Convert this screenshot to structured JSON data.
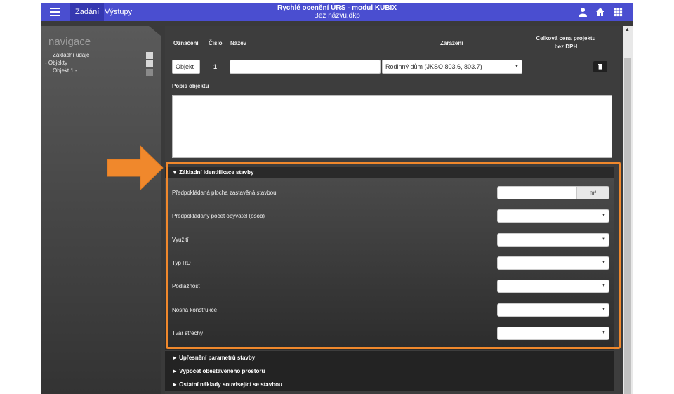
{
  "header": {
    "title": "Rychlé ocenění ÚRS - modul KUBIX",
    "subtitle": "Bez názvu.dkp",
    "tabs": [
      {
        "label": "Zadání",
        "active": true
      },
      {
        "label": "Výstupy",
        "active": false
      }
    ],
    "icons": [
      "menu-icon",
      "user-icon",
      "home-icon",
      "grid-icon"
    ]
  },
  "sidebar": {
    "title": "navigace",
    "items": [
      {
        "label": "Základní údaje"
      },
      {
        "label": "-  Objekty"
      },
      {
        "label": "Objekt 1 -"
      }
    ]
  },
  "object": {
    "headers": {
      "designation": "Označení",
      "number": "Číslo",
      "name": "Název",
      "classification": "Zařazení",
      "total_price": "Celková cena projektu",
      "total_price_sub": "bez DPH"
    },
    "designation_value": "Objekt",
    "number_value": "1",
    "name_value": "",
    "classification_value": "Rodinný dům (JKSO 803.6, 803.7)",
    "description_label": "Popis objektu",
    "description_value": ""
  },
  "section_basic": {
    "title": "▼ Základní identifikace stavby",
    "rows": [
      {
        "label": "Předpokládaná plocha zastavěná stavbou",
        "value": "",
        "unit": "m²"
      },
      {
        "label": "Předpokládaný počet obyvatel (osob)",
        "value": ""
      },
      {
        "label": "Využití",
        "value": ""
      },
      {
        "label": "Typ RD",
        "value": ""
      },
      {
        "label": "Podlažnost",
        "value": ""
      },
      {
        "label": "Nosná konstrukce",
        "value": ""
      },
      {
        "label": "Tvar střechy",
        "value": ""
      }
    ]
  },
  "collapsed_sections": [
    {
      "title": "► Upřesnění parametrů stavby"
    },
    {
      "title": "► Výpočet obestavěného prostoru"
    },
    {
      "title": "► Ostatní náklady související se stavbou"
    }
  ],
  "colors": {
    "topbar": "#4a4ed0",
    "highlight": "#f0882c",
    "panel": "#3d3d3d"
  }
}
